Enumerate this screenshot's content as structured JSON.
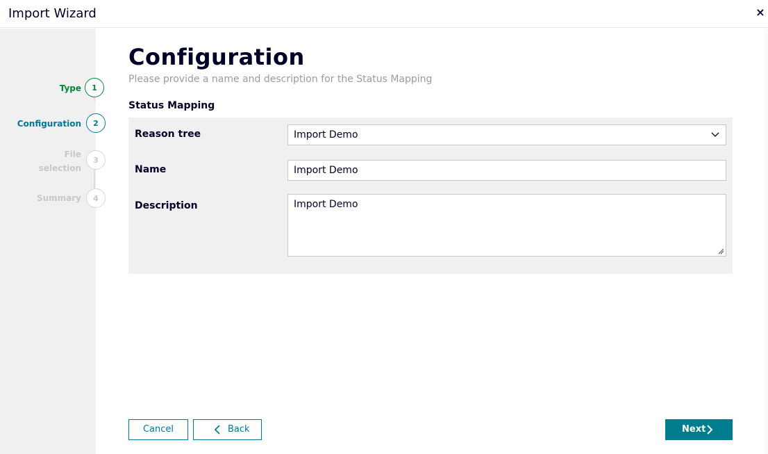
{
  "window": {
    "title": "Import Wizard",
    "close_label": "×"
  },
  "steps": [
    {
      "label": "Type",
      "number": "1",
      "state": "completed",
      "color": "#00883a"
    },
    {
      "label": "Configuration",
      "number": "2",
      "state": "active",
      "color": "#00789e"
    },
    {
      "label": "File selection",
      "number": "3",
      "state": "disabled",
      "color": "#c8c8cc"
    },
    {
      "label": "Summary",
      "number": "4",
      "state": "disabled",
      "color": "#c8c8cc"
    }
  ],
  "main": {
    "heading": "Configuration",
    "subheading": "Please provide a name and description for the Status Mapping",
    "section_title": "Status Mapping"
  },
  "form": {
    "reason_tree": {
      "label": "Reason tree",
      "value": "Import Demo"
    },
    "name": {
      "label": "Name",
      "value": "Import Demo"
    },
    "description": {
      "label": "Description",
      "value": "Import Demo"
    }
  },
  "buttons": {
    "cancel": "Cancel",
    "back": "Back",
    "next": "Next"
  },
  "colors": {
    "accent": "#00789e",
    "primary_button": "#007c8f",
    "success": "#00883a",
    "sidebar_bg": "#f0f0f0"
  }
}
